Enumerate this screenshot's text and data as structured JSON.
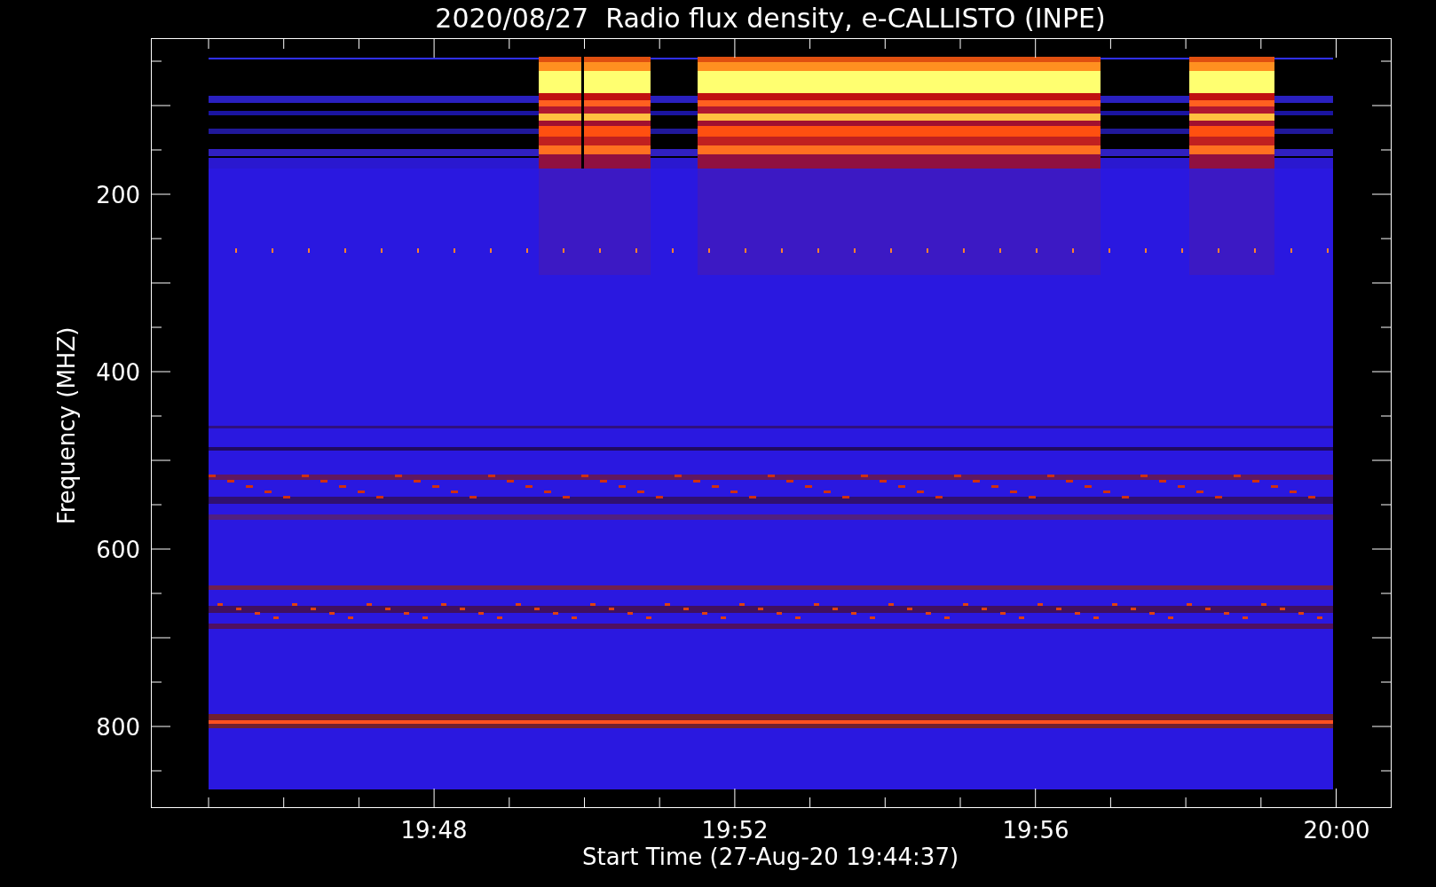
{
  "plot": {
    "title": "2020/08/27  Radio flux density, e-CALLISTO (INPE)",
    "ylabel": "Frequency (MHZ)",
    "xlabel": "Start Time (27-Aug-20 19:44:37)",
    "yticks": [
      "200",
      "400",
      "600",
      "800"
    ],
    "xticks": [
      "19:48",
      "19:52",
      "19:56",
      "20:00"
    ]
  }
}
